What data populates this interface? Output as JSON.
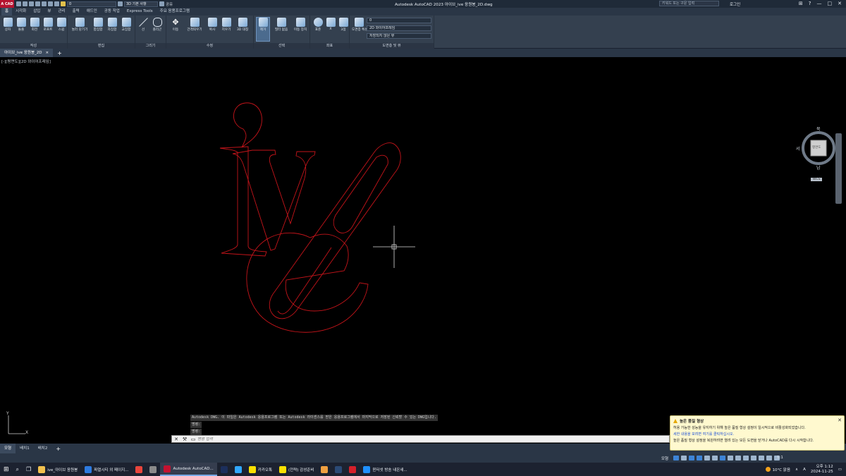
{
  "titlebar": {
    "app_logo": "A CAD",
    "layer_combo": "0",
    "workspace": "3D 기본 사항",
    "share": "공유",
    "window_title": "Autodesk AutoCAD 2023    아이브_ive 응원봉_2D.dwg",
    "search_placeholder": "키워드 또는 구문 입력",
    "login": "로그인",
    "cart_icon": "cart-icon",
    "help_icon": "help-icon"
  },
  "ribbon_tabs": [
    "홈",
    "시각화",
    "삽입",
    "뷰",
    "관리",
    "출력",
    "애드인",
    "공동 작업",
    "Express Tools",
    "주요 응용프로그램"
  ],
  "ribbon": {
    "panels": [
      {
        "title": "작성",
        "tools": [
          "상자",
          "돌출",
          "회전",
          "로프트",
          "스윕"
        ]
      },
      {
        "title": "편집",
        "tools": [
          "눌러 당기기",
          "합집합",
          "차집합",
          "교집합"
        ]
      },
      {
        "title": "그리기",
        "tools": [
          "선",
          "폴리곤"
        ]
      },
      {
        "title": "수정",
        "tools": [
          "이동",
          "간격띄우기",
          "복사",
          "지우기",
          "3D 대칭"
        ]
      },
      {
        "title": "선택",
        "tools": [
          "제거",
          "필터 없음",
          "이동 장치"
        ]
      },
      {
        "title": "좌표",
        "tools": [
          "표준",
          "X",
          "3점"
        ]
      },
      {
        "title": "도면층 및 뷰",
        "tools": [
          "도면층 특성"
        ]
      }
    ],
    "visual_style": "2D 와이어프레임",
    "view_combo": "저장되지 않은 뷰",
    "layer_value": "0"
  },
  "doc_tab": {
    "name": "아이브_ive 응원봉_2D",
    "close": "×"
  },
  "viewport": {
    "label": "[-][평면도][2D 와이어프레임]",
    "cube": {
      "n": "북",
      "s": "남",
      "e": "동",
      "w": "서",
      "face": "평면도",
      "wcs": "WCS"
    },
    "drawing_color": "#c4141a"
  },
  "command": {
    "lines": [
      "Autodesk DWG.  이 파일은 Autodesk 응용프로그램 또는 Autodesk 라이센스를 받은 응용프로그램에서 마지막으로 저장된 신뢰할 수 있는 DWG입니다.",
      "명령:",
      "명령:"
    ],
    "placeholder": "명령 입력"
  },
  "layout_tabs": [
    "모형",
    "배치1",
    "배치2"
  ],
  "status": {
    "model": "모형",
    "scale": "1:1"
  },
  "notification": {
    "title": "높은 품질 형상",
    "line1": "허용 가능한 성능을 유지하기 위해 높은 품질 형상 설정이 일시적으로 비활성화되었습니다.",
    "link": "세한 내용을 보려면 여기를 클릭하십시오.",
    "line2": "높은 품질 형상 설정을 복원하려면 열려 있는 모든 도면을 닫거나 AutoCAD를 다시 시작합니다."
  },
  "taskbar": {
    "items": [
      {
        "label": "ive_아이브 응원봉",
        "color": "#f2c14e"
      },
      {
        "label": "파열시티 외 페이지...",
        "color": "#2d7be0"
      },
      {
        "label": "",
        "color": "#e8453c"
      },
      {
        "label": "",
        "color": "#8a8a8a"
      },
      {
        "label": "Autodesk AutoCAD...",
        "color": "#c41230"
      },
      {
        "label": "",
        "color": "#1c2f5c"
      },
      {
        "label": "",
        "color": "#31a8ff"
      },
      {
        "label": "카카오톡",
        "color": "#f9e000"
      },
      {
        "label": "(전략) 감성준비",
        "color": "#f9e000"
      },
      {
        "label": "",
        "color": "#f0a040"
      },
      {
        "label": "",
        "color": "#2b4a75"
      },
      {
        "label": "",
        "color": "#d6202a"
      },
      {
        "label": "윈터넷 방송 내온새...",
        "color": "#1e90ff"
      }
    ],
    "weather": "10°C 맑음",
    "time": "오후 1:12",
    "date": "2024-11-25"
  }
}
